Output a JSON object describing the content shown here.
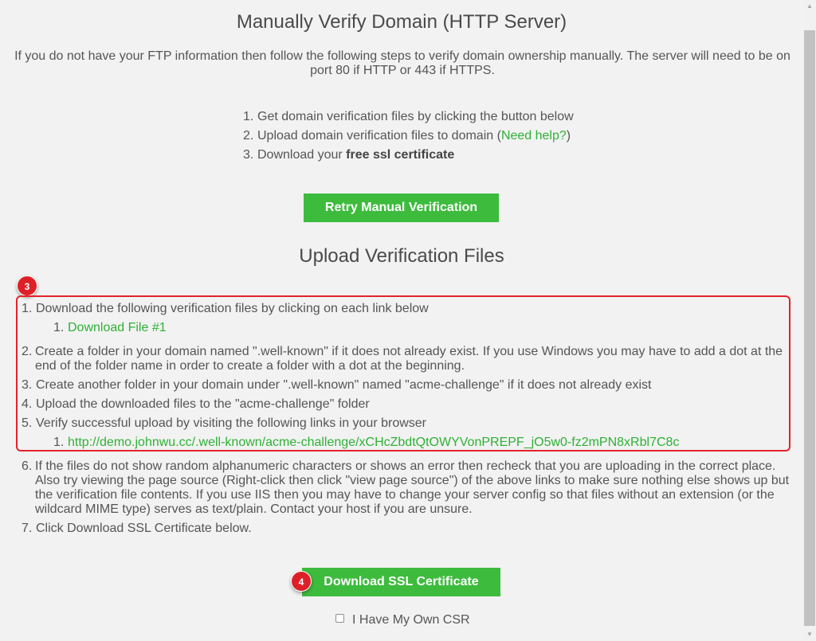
{
  "title": "Manually Verify Domain (HTTP Server)",
  "intro": "If you do not have your FTP information then follow the following steps to verify domain ownership manually. The server will need to be on port 80 if HTTP or 443 if HTTPS.",
  "steps": [
    {
      "num": "1.",
      "text": "Get domain verification files by clicking the button below"
    },
    {
      "num": "2.",
      "text_before": "Upload domain verification files to domain (",
      "link": "Need help?",
      "text_after": ")"
    },
    {
      "num": "3.",
      "text_before": "Download your ",
      "bold": "free ssl certificate"
    }
  ],
  "retry_button": "Retry Manual Verification",
  "upload_title": "Upload Verification Files",
  "badges": {
    "first": "3",
    "second": "4"
  },
  "instructions": [
    {
      "num": "1.",
      "text": "Download the following verification files by clicking on each link below",
      "sub": {
        "num": "1.",
        "link": "Download File #1"
      }
    },
    {
      "num": "2.",
      "text": "Create a folder in your domain named \".well-known\" if it does not already exist. If you use Windows you may have to add a dot at the end of the folder name in order to create a folder with a dot at the beginning."
    },
    {
      "num": "3.",
      "text": "Create another folder in your domain under \".well-known\" named \"acme-challenge\" if it does not already exist"
    },
    {
      "num": "4.",
      "text": "Upload the downloaded files to the \"acme-challenge\" folder"
    },
    {
      "num": "5.",
      "text": "Verify successful upload by visiting the following links in your browser",
      "sub": {
        "num": "1.",
        "link": "http://demo.johnwu.cc/.well-known/acme-challenge/xCHcZbdtQtOWYVonPREPF_jO5w0-fz2mPN8xRbl7C8c"
      }
    },
    {
      "num": "6.",
      "text": "If the files do not show random alphanumeric characters or shows an error then recheck that you are uploading in the correct place. Also try viewing the page source (Right-click then click \"view page source\") of the above links to make sure nothing else shows up but the verification file contents. If you use IIS then you may have to change your server config so that files without an extension (or the wildcard MIME type) serves as text/plain. Contact your host if you are unsure."
    },
    {
      "num": "7.",
      "text": "Click Download SSL Certificate below."
    }
  ],
  "download_button": "Download SSL Certificate",
  "csr_checkbox_label": "I Have My Own CSR",
  "colors": {
    "accent_green": "#3dbb3d",
    "link_green": "#2eb135",
    "highlight_red": "#e3232b"
  },
  "icons": {
    "scroll_up": "scroll-up-arrow-icon",
    "scroll_down": "scroll-down-arrow-icon"
  }
}
